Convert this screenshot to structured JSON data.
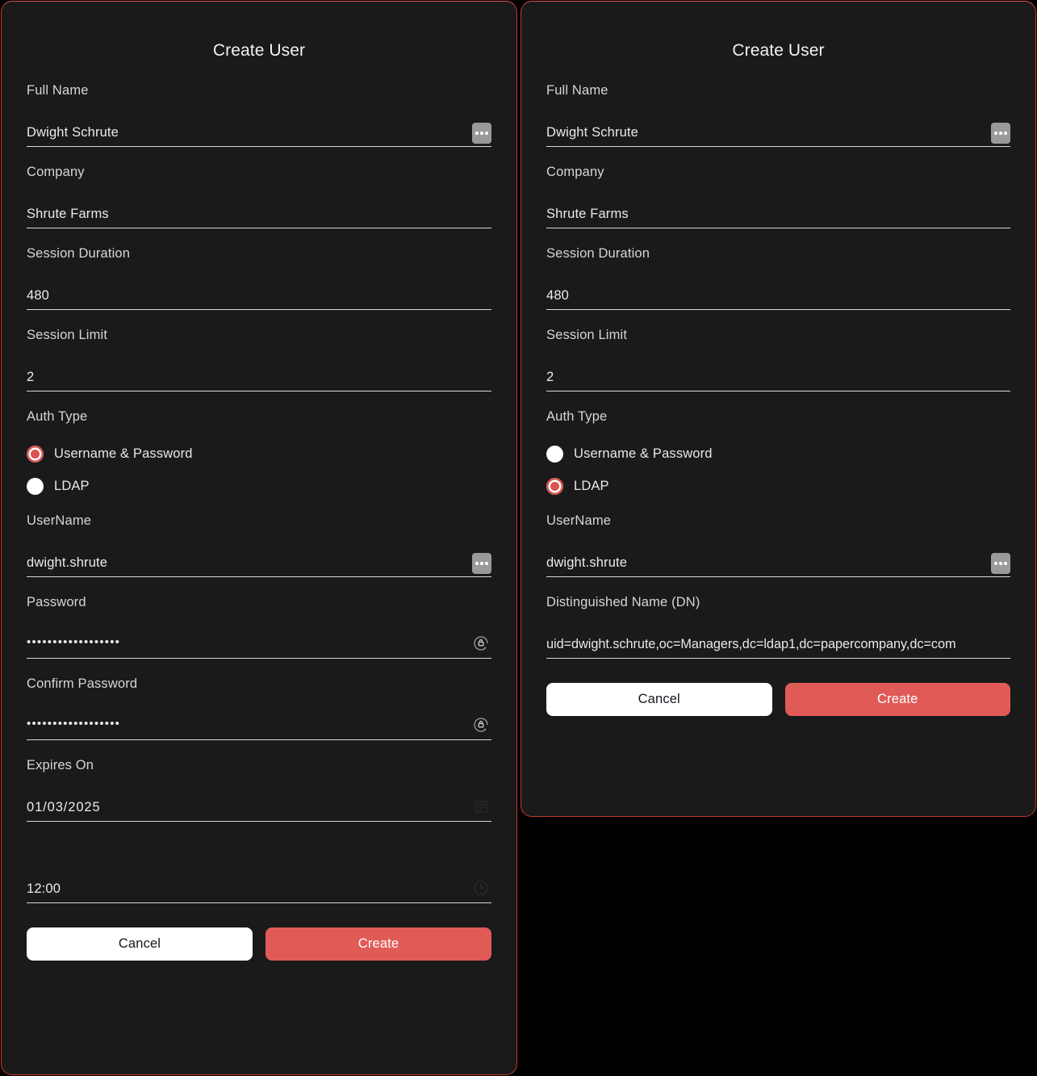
{
  "theme": {
    "page_bg": "#000000",
    "panel_bg": "#1a1a1a",
    "panel_border": "#c0392b",
    "accent": "#d9534f",
    "create_button_bg": "#e05b58",
    "cancel_button_bg": "#ffffff",
    "text_primary": "#eaeaea",
    "label_color": "#d6d6d6",
    "underline_color": "#d8d8d6",
    "autofill_chip_bg": "#9a9a9a"
  },
  "left_dialog": {
    "title": "Create User",
    "fields": {
      "full_name": {
        "label": "Full Name",
        "value": "Dwight Schrute",
        "adornment": "autofill-chip"
      },
      "company": {
        "label": "Company",
        "value": "Shrute Farms",
        "adornment": "none"
      },
      "session_duration": {
        "label": "Session Duration",
        "value": "480",
        "adornment": "none"
      },
      "session_limit": {
        "label": "Session Limit",
        "value": "2",
        "adornment": "none"
      },
      "auth_type": {
        "label": "Auth Type",
        "options": [
          {
            "label": "Username & Password",
            "selected": true
          },
          {
            "label": "LDAP",
            "selected": false
          }
        ]
      },
      "username": {
        "label": "UserName",
        "value": "dwight.shrute",
        "adornment": "autofill-chip"
      },
      "password": {
        "label": "Password",
        "value": "••••••••••••••••••",
        "adornment": "generate-password-icon"
      },
      "confirm_password": {
        "label": "Confirm Password",
        "value": "••••••••••••••••••",
        "adornment": "generate-password-icon"
      },
      "expires_on": {
        "label": "Expires On",
        "value": "01/03/2025",
        "adornment": "calendar-icon"
      },
      "expires_time": {
        "label": "",
        "value": "12:00",
        "adornment": "clock-icon"
      }
    },
    "buttons": {
      "cancel": "Cancel",
      "create": "Create"
    }
  },
  "right_dialog": {
    "title": "Create User",
    "fields": {
      "full_name": {
        "label": "Full Name",
        "value": "Dwight Schrute",
        "adornment": "autofill-chip"
      },
      "company": {
        "label": "Company",
        "value": "Shrute Farms",
        "adornment": "none"
      },
      "session_duration": {
        "label": "Session Duration",
        "value": "480",
        "adornment": "none"
      },
      "session_limit": {
        "label": "Session Limit",
        "value": "2",
        "adornment": "none"
      },
      "auth_type": {
        "label": "Auth Type",
        "options": [
          {
            "label": "Username & Password",
            "selected": false
          },
          {
            "label": "LDAP",
            "selected": true
          }
        ]
      },
      "username": {
        "label": "UserName",
        "value": "dwight.shrute",
        "adornment": "autofill-chip"
      },
      "distinguished_name": {
        "label": "Distinguished Name (DN)",
        "value": "uid=dwight.schrute,oc=Managers,dc=ldap1,dc=papercompany,dc=com",
        "adornment": "none"
      }
    },
    "buttons": {
      "cancel": "Cancel",
      "create": "Create"
    }
  }
}
